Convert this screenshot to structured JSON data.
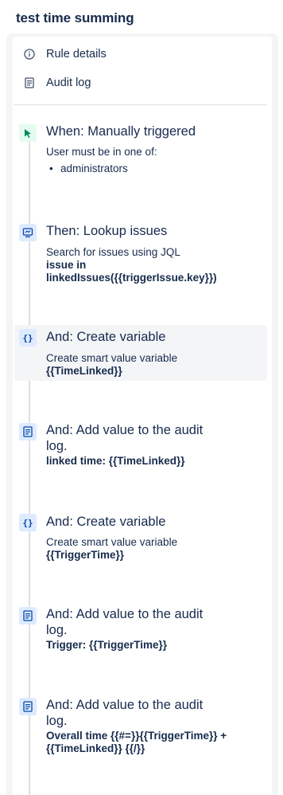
{
  "rule": {
    "title": "test time summing"
  },
  "menu": {
    "rule_details": "Rule details",
    "audit_log": "Audit log"
  },
  "components": [
    {
      "title": "When: Manually triggered",
      "desc_line1": "User must be in one of:",
      "bullet": "administrators",
      "icon": "cursor-click-icon"
    },
    {
      "title": "Then: Lookup issues",
      "desc_line1": "Search for issues using JQL",
      "bold_line1": "issue in",
      "bold_line2": "linkedIssues({{triggerIssue.key}})",
      "icon": "monitor-icon"
    },
    {
      "title": "And: Create variable",
      "desc_line1": "Create smart value variable",
      "bold_line1": "{{TimeLinked}}",
      "icon": "braces-icon"
    },
    {
      "title_line1": "And: Add value to the audit",
      "title_line2": "log.",
      "bold_line1": "linked time: {{TimeLinked}}",
      "icon": "audit-log-icon"
    },
    {
      "title": "And: Create variable",
      "desc_line1": "Create smart value variable",
      "bold_line1": "{{TriggerTime}}",
      "icon": "braces-icon"
    },
    {
      "title_line1": "And: Add value to the audit",
      "title_line2": "log.",
      "bold_line1": "Trigger: {{TriggerTime}}",
      "icon": "audit-log-icon"
    },
    {
      "title_line1": "And: Add value to the audit",
      "title_line2": "log.",
      "bold_line1": "Overall time {{#=}}{{TriggerTime}} +",
      "bold_line2": "{{TimeLinked}} {{/}}",
      "icon": "audit-log-icon"
    }
  ],
  "braces_glyph": "{}",
  "colors": {
    "accent": "#0052cc",
    "trigger_green": "#00875a"
  }
}
